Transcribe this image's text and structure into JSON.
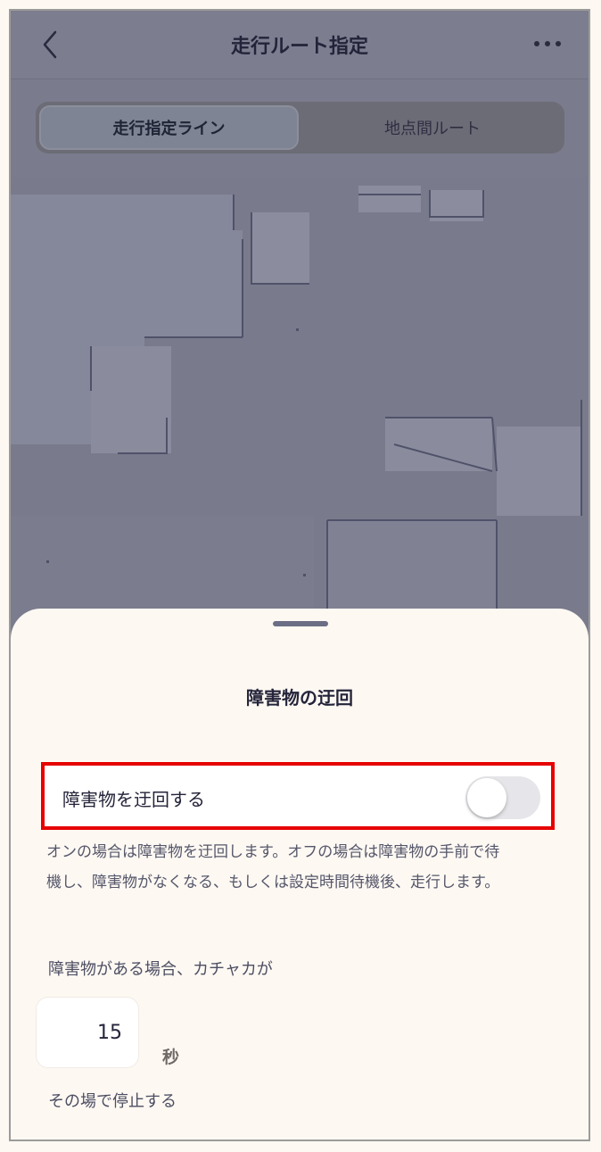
{
  "header": {
    "title": "走行ルート指定",
    "back_icon": "chevron-left-icon",
    "more_icon": "more-horizontal-icon"
  },
  "segments": {
    "active_label": "走行指定ライン",
    "inactive_label": "地点間ルート"
  },
  "sheet": {
    "title": "障害物の迂回",
    "toggle": {
      "label": "障害物を迂回する",
      "state": "off"
    },
    "description_line1": "オンの場合は障害物を迂回します。オフの場合は障害物の手前で待",
    "description_line2": "機し、障害物がなくなる、もしくは設定時間待機後、走行します。",
    "wait_label": "障害物がある場合、カチャカが",
    "seconds_value": "15",
    "seconds_unit": "秒",
    "stop_label": "その場で停止する"
  },
  "colors": {
    "highlight_border": "#e60000",
    "sheet_background": "#fdf8f2",
    "dim_overlay": "#7a7b8c"
  }
}
